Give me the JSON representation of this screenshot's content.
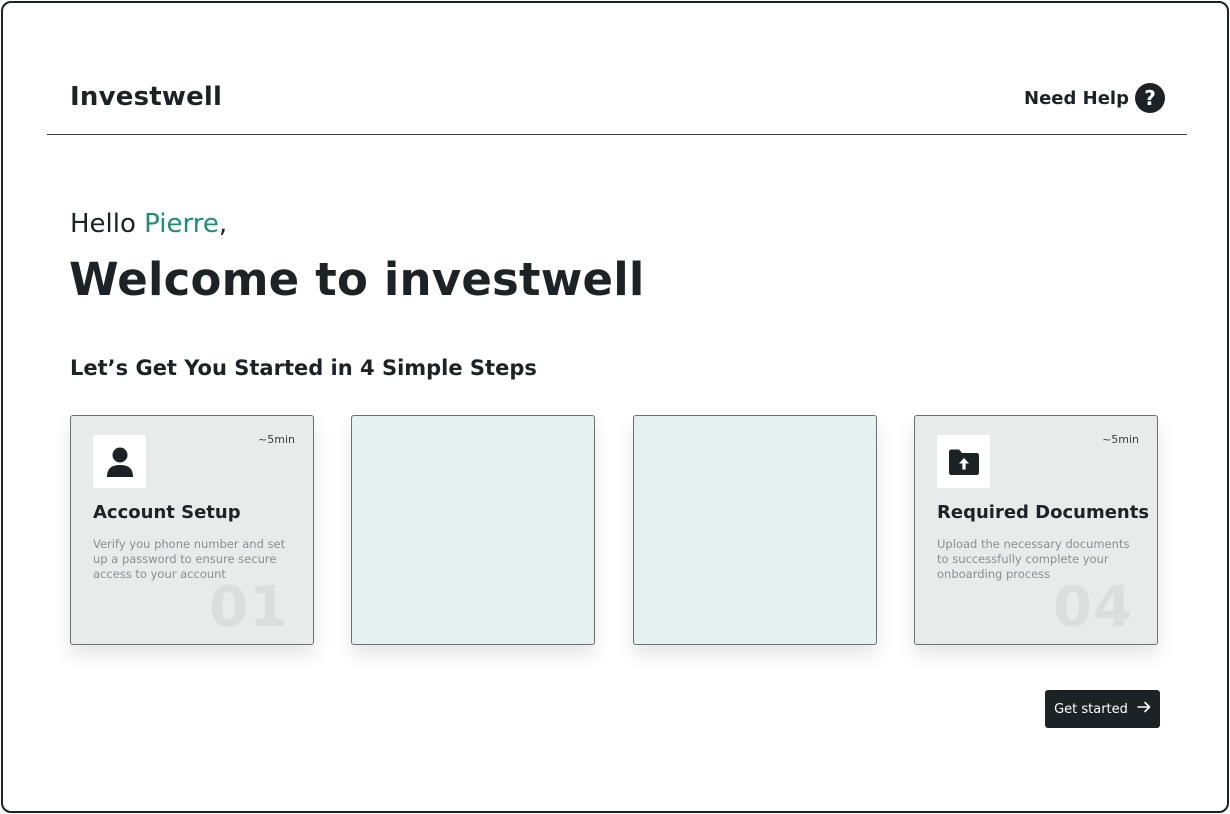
{
  "header": {
    "brand": "Investwell",
    "help_label": "Need Help",
    "help_icon": "question-circle-icon"
  },
  "greeting": {
    "prefix": "Hello ",
    "name": "Pierre",
    "suffix": ",",
    "name_color": "#1a8f7a"
  },
  "welcome_title": "Welcome to investwell",
  "steps_heading": "Let’s Get You Started in 4 Simple Steps",
  "cards": [
    {
      "icon": "user-icon",
      "time": "~5min",
      "title": "Account Setup",
      "description": "Verify you phone number and set up a password to ensure secure access to your account",
      "number": "01"
    },
    {},
    {},
    {
      "icon": "folder-upload-icon",
      "time": "~5min",
      "title": "Required Documents",
      "description": "Upload the necessary documents to successfully complete your onboarding process",
      "number": "04"
    }
  ],
  "cta": {
    "label": "Get started",
    "icon": "arrow-right-icon"
  },
  "colors": {
    "accent": "#1a8f7a",
    "dark": "#1c2226",
    "card_filled": "#e9eaea",
    "card_empty": "#e5f1f1"
  }
}
